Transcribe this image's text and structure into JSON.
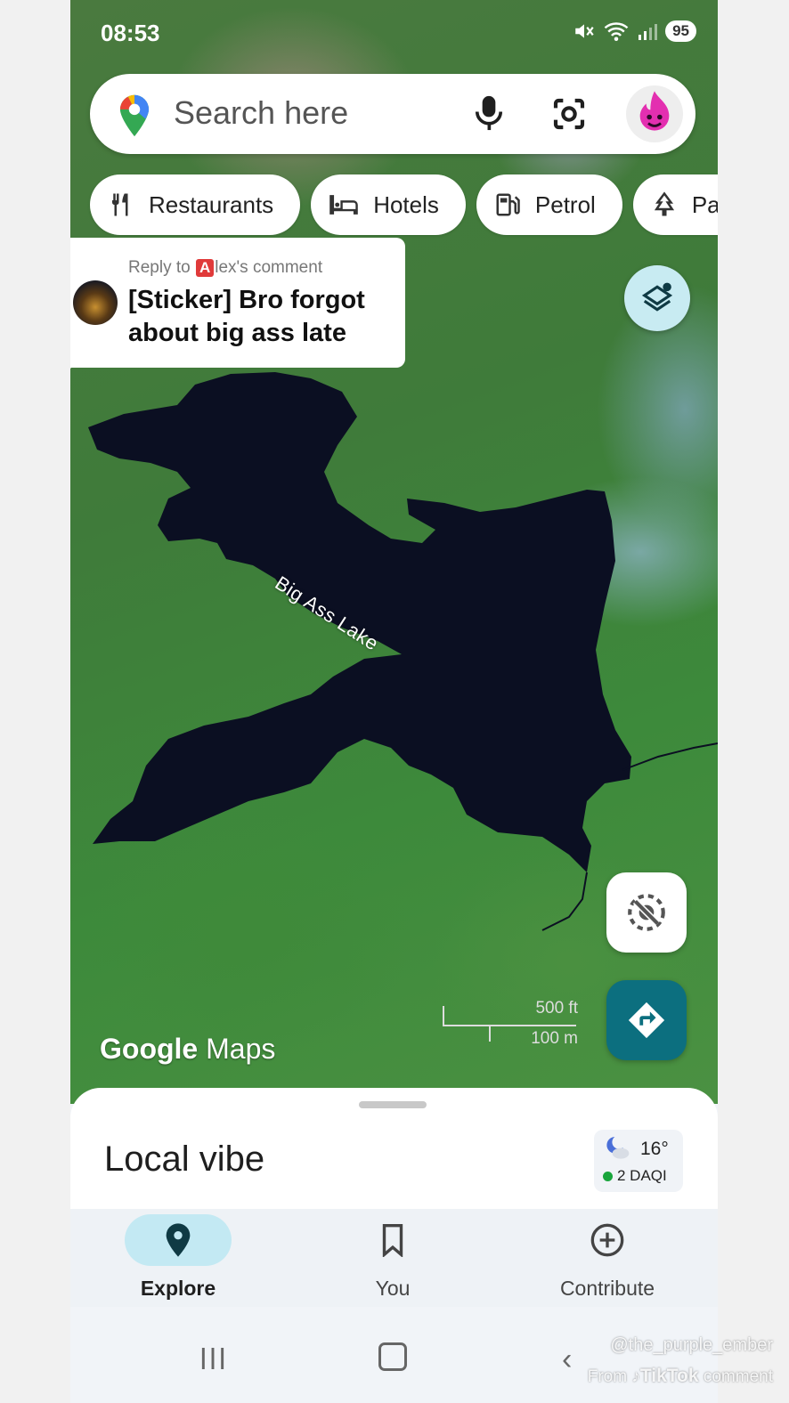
{
  "status_bar": {
    "time": "08:53",
    "battery": "95"
  },
  "search": {
    "placeholder": "Search here"
  },
  "chips": [
    {
      "label": "Restaurants",
      "icon": "fork-knife-icon"
    },
    {
      "label": "Hotels",
      "icon": "bed-icon"
    },
    {
      "label": "Petrol",
      "icon": "gas-station-icon"
    },
    {
      "label": "Pa",
      "icon": "tree-icon"
    }
  ],
  "reply": {
    "prefix": "Reply to ",
    "badge": "A",
    "suffix": "lex's comment",
    "text": "[Sticker] Bro forgot about big ass late"
  },
  "map": {
    "lake_label": "Big Ass Lake",
    "logo_google": "Google",
    "logo_maps": "Maps",
    "scale_ft": "500 ft",
    "scale_m": "100 m"
  },
  "sheet": {
    "title": "Local vibe",
    "temperature": "16°",
    "aqi": "2 DAQI"
  },
  "nav": {
    "explore": "Explore",
    "you": "You",
    "contribute": "Contribute"
  },
  "watermark": {
    "user": "@the_purple_ember",
    "from": "From",
    "brand": "TikTok",
    "suffix": "comment"
  },
  "colors": {
    "accent": "#0c6f7f",
    "nav_active_pill": "#c3e9f3",
    "layers_button": "#c8ebf2",
    "aqi_good": "#19a53c"
  }
}
